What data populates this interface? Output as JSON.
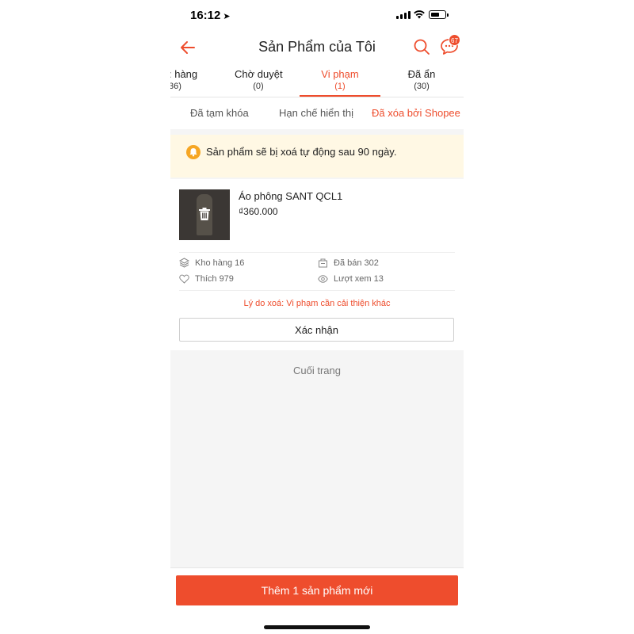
{
  "status_bar": {
    "time": "16:12",
    "location_arrow": "location-arrow-icon"
  },
  "header": {
    "title": "Sản Phẩm của Tôi",
    "chat_badge": "67",
    "accent": "#ee4d2d"
  },
  "tabs": [
    {
      "label": ": hàng",
      "count": "36)"
    },
    {
      "label": "Chờ duyệt",
      "count": "(0)"
    },
    {
      "label": "Vi phạm",
      "count": "(1)",
      "active": true
    },
    {
      "label": "Đã ẩn",
      "count": "(30)"
    }
  ],
  "subtabs": [
    {
      "label": "Đã tạm khóa"
    },
    {
      "label": "Hạn chế hiển thị"
    },
    {
      "label": "Đã xóa bởi Shopee",
      "active": true
    }
  ],
  "notice": {
    "text": "Sản phẩm sẽ bị xoá tự động sau 90 ngày.",
    "icon": "bell-icon"
  },
  "product": {
    "name": "Áo phông SANT QCL1",
    "price": "₫360.000",
    "stock": "Kho hàng 16",
    "sold": "Đã bán 302",
    "likes": "Thích 979",
    "views": "Lượt xem 13",
    "delete_reason": "Lý do xoá: Vi phạm cần cải thiện khác",
    "confirm_label": "Xác nhận"
  },
  "end_label": "Cuối trang",
  "add_button_label": "Thêm 1 sản phẩm mới"
}
